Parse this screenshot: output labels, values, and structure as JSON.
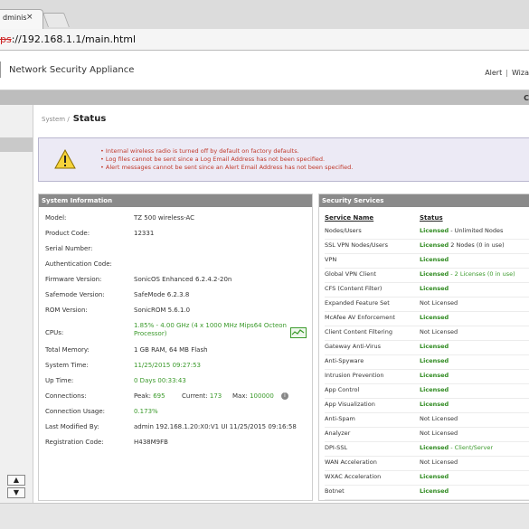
{
  "browser": {
    "tab_title": "dminis",
    "tab_close": "×",
    "url_protocol": "ps",
    "url_rest": "://192.168.1.1/main.html"
  },
  "header": {
    "app_name": "Network Security Appliance",
    "links": [
      "Alert",
      "Wiza"
    ],
    "link_sep": "|"
  },
  "band": {
    "edge_text": "C"
  },
  "breadcrumb": {
    "section": "System /",
    "title": "Status"
  },
  "alerts": [
    "Internal wireless radio is turned off by default on factory defaults.",
    "Log files cannot be sent since a Log Email Address has not been specified.",
    "Alert messages cannot be sent since an Alert Email Address has not been specified."
  ],
  "system_info": {
    "title": "System Information",
    "model_label": "Model:",
    "model": "TZ 500 wireless-AC",
    "product_code_label": "Product Code:",
    "product_code": "12331",
    "serial_label": "Serial Number:",
    "serial": "",
    "auth_label": "Authentication Code:",
    "auth": "",
    "firmware_label": "Firmware Version:",
    "firmware": "SonicOS Enhanced 6.2.4.2-20n",
    "safemode_label": "Safemode Version:",
    "safemode": "SafeMode 6.2.3.8",
    "rom_label": "ROM Version:",
    "rom": "SonicROM 5.6.1.0",
    "cpus_label": "CPUs:",
    "cpus_line1": "1.85% - 4.00 GHz (4 x 1000 MHz Mips64 Octeon",
    "cpus_line2": "Processor)",
    "memory_label": "Total Memory:",
    "memory": "1 GB RAM, 64 MB Flash",
    "systime_label": "System Time:",
    "systime": "11/25/2015 09:27:53",
    "uptime_label": "Up Time:",
    "uptime": "0 Days 00:33:43",
    "connections_label": "Connections:",
    "peak_label": "Peak:",
    "peak": "695",
    "current_label": "Current:",
    "current": "173",
    "max_label": "Max:",
    "max": "100000",
    "conn_usage_label": "Connection Usage:",
    "conn_usage": "0.173%",
    "last_modified_label": "Last Modified By:",
    "last_modified": "admin 192.168.1.20:X0:V1 UI 11/25/2015 09:16:58",
    "reg_label": "Registration Code:",
    "reg": "H438M9FB"
  },
  "security_services": {
    "title": "Security Services",
    "col_name": "Service Name",
    "col_status": "Status",
    "rows": [
      {
        "name": "Nodes/Users",
        "status": "Licensed",
        "extra": " - Unlimited Nodes",
        "licensed": true
      },
      {
        "name": "SSL VPN Nodes/Users",
        "status": "Licensed",
        "extra": " 2 Nodes (0 in use)",
        "licensed": true
      },
      {
        "name": "VPN",
        "status": "Licensed",
        "extra": "",
        "licensed": true
      },
      {
        "name": "Global VPN Client",
        "status": "Licensed",
        "extra": " - 2 Licenses (0 in use)",
        "licensed": true,
        "extra_green": true
      },
      {
        "name": "CFS (Content Filter)",
        "status": "Licensed",
        "extra": "",
        "licensed": true
      },
      {
        "name": "Expanded Feature Set",
        "status": "Not Licensed",
        "extra": "",
        "licensed": false
      },
      {
        "name": "McAfee AV Enforcement",
        "status": "Licensed",
        "extra": "",
        "licensed": true
      },
      {
        "name": "Client Content Filtering",
        "status": "Not Licensed",
        "extra": "",
        "licensed": false
      },
      {
        "name": "Gateway Anti-Virus",
        "status": "Licensed",
        "extra": "",
        "licensed": true
      },
      {
        "name": "Anti-Spyware",
        "status": "Licensed",
        "extra": "",
        "licensed": true
      },
      {
        "name": "Intrusion Prevention",
        "status": "Licensed",
        "extra": "",
        "licensed": true
      },
      {
        "name": "App Control",
        "status": "Licensed",
        "extra": "",
        "licensed": true
      },
      {
        "name": "App Visualization",
        "status": "Licensed",
        "extra": "",
        "licensed": true
      },
      {
        "name": "Anti-Spam",
        "status": "Not Licensed",
        "extra": "",
        "licensed": false
      },
      {
        "name": "Analyzer",
        "status": "Not Licensed",
        "extra": "",
        "licensed": false
      },
      {
        "name": "DPI-SSL",
        "status": "Licensed",
        "extra": " - Client/Server",
        "licensed": true,
        "extra_green": true
      },
      {
        "name": "WAN Acceleration",
        "status": "Not Licensed",
        "extra": "",
        "licensed": false
      },
      {
        "name": "WXAC Acceleration",
        "status": "Licensed",
        "extra": "",
        "licensed": true
      },
      {
        "name": "Botnet",
        "status": "Licensed",
        "extra": "",
        "licensed": true
      }
    ]
  },
  "colors": {
    "licensed": "#2e8a1f",
    "not_licensed": "#333333",
    "alert_text": "#c0392b",
    "panel_header": "#8a8a8a"
  },
  "icons": {
    "warning": "warning-triangle-icon",
    "cpu": "cpu-monitor-icon",
    "connections": "info-icon",
    "scroll_up": "arrow-up-icon",
    "scroll_down": "arrow-down-icon"
  }
}
